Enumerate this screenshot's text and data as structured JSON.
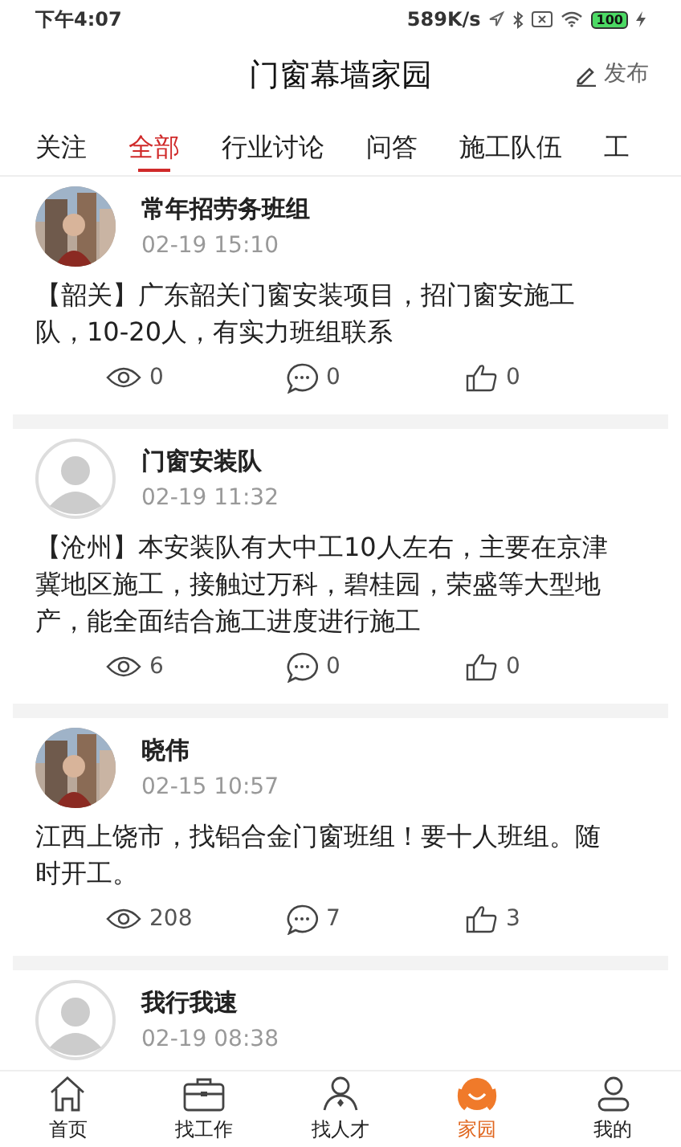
{
  "status_bar": {
    "time": "下午4:07",
    "speed": "589K/s",
    "battery": "100"
  },
  "header": {
    "title": "门窗幕墙家园",
    "action": "发布"
  },
  "tabs": [
    {
      "label": "关注",
      "selected": false
    },
    {
      "label": "全部",
      "selected": true
    },
    {
      "label": "行业讨论",
      "selected": false
    },
    {
      "label": "问答",
      "selected": false
    },
    {
      "label": "施工队伍",
      "selected": false
    },
    {
      "label": "工",
      "selected": false
    }
  ],
  "posts": [
    {
      "author": "常年招劳务班组",
      "time": "02-19 15:10",
      "text": "【韶关】广东韶关门窗安装项目，招门窗安施工队，10-20人，有实力班组联系",
      "views": "0",
      "comments": "0",
      "likes": "0"
    },
    {
      "author": "门窗安装队",
      "time": "02-19 11:32",
      "avatar": {
        "kind": "default"
      },
      "text": "【沧州】本安装队有大中工10人左右，主要在京津冀地区施工，接触过万科，碧桂园，荣盛等大型地产，能全面结合施工进度进行施工",
      "views": "6",
      "comments": "0",
      "likes": "0"
    },
    {
      "author": "晓伟",
      "time": "02-15 10:57",
      "text": "江西上饶市，找铝合金门窗班组！要十人班组。随时开工。",
      "views": "208",
      "comments": "7",
      "likes": "3"
    },
    {
      "author": "我行我速",
      "time": "02-19 08:38",
      "avatar": {
        "kind": "default"
      }
    }
  ],
  "bottom_nav": [
    {
      "label": "首页",
      "kind": "home",
      "selected": false
    },
    {
      "label": "找工作",
      "kind": "briefcase",
      "selected": false
    },
    {
      "label": "找人才",
      "kind": "person",
      "selected": false
    },
    {
      "label": "家园",
      "kind": "community",
      "selected": true
    },
    {
      "label": "我的",
      "kind": "profile",
      "selected": false
    }
  ]
}
